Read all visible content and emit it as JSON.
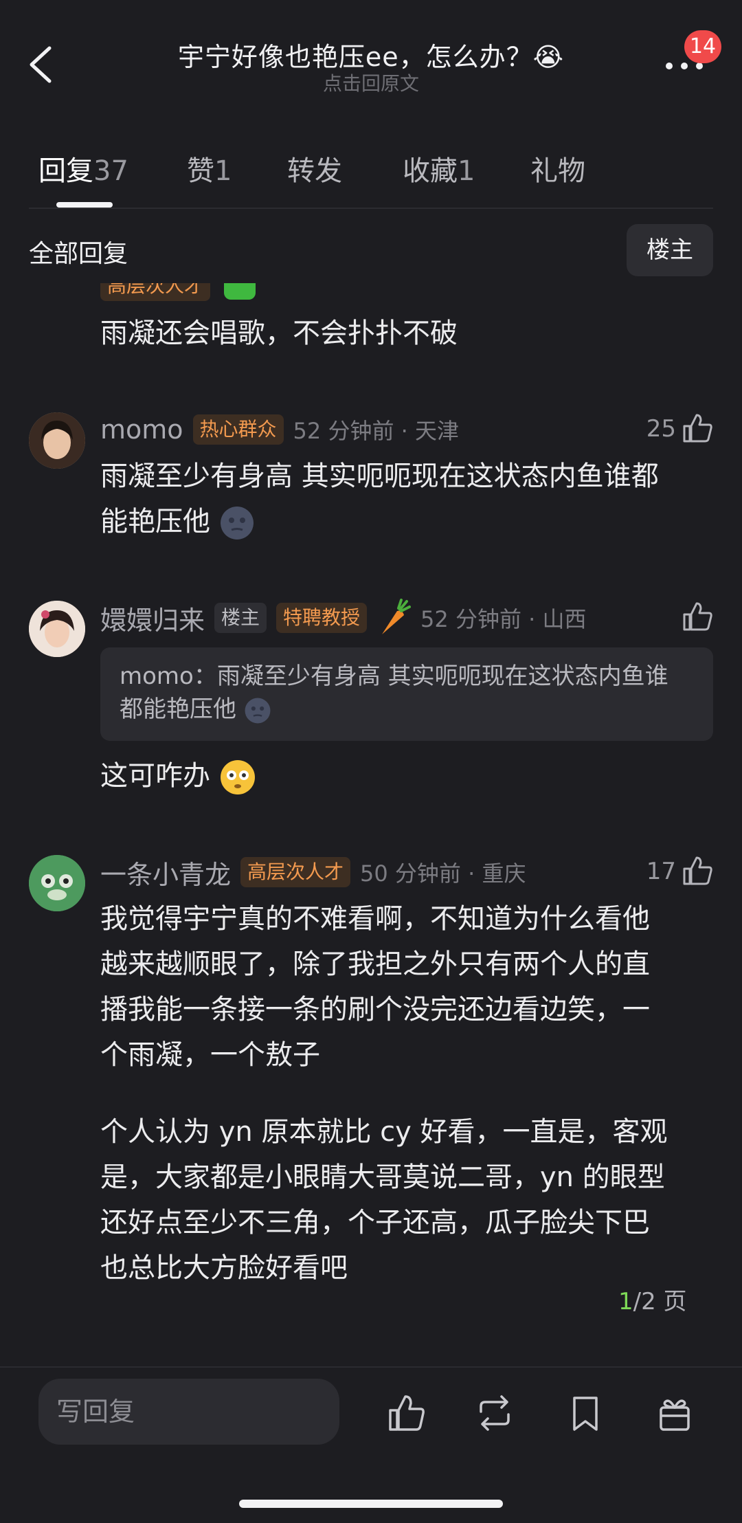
{
  "header": {
    "title": "宇宁好像也艳压ee，怎么办？😭",
    "subtitle": "点击回原文",
    "notification_count": "14"
  },
  "tabs": [
    {
      "label": "回复",
      "count": "37",
      "active": true
    },
    {
      "label": "赞",
      "count": "1",
      "active": false
    },
    {
      "label": "转发",
      "count": "",
      "active": false
    },
    {
      "label": "收藏",
      "count": "1",
      "active": false
    },
    {
      "label": "礼物",
      "count": "",
      "active": false
    }
  ],
  "section": {
    "title": "全部回复",
    "owner_filter": "楼主"
  },
  "comments": [
    {
      "username": "",
      "badge": "高层次人才",
      "content": "雨凝还会唱歌，不会扑扑不破"
    },
    {
      "username": "momo",
      "badge": "热心群众",
      "meta": "52 分钟前 · 天津",
      "likes": "25",
      "content_line1": "雨凝至少有身高 其实呃呃现在这状态内鱼谁都",
      "content_line2": "能艳压他"
    },
    {
      "username": "嬛嬛归来",
      "badge_owner": "楼主",
      "badge": "特聘教授",
      "meta": "52 分钟前 · 山西",
      "likes": "",
      "quote_line1": "momo：雨凝至少有身高 其实呃呃现在这状态内鱼谁",
      "quote_line2": "都能艳压他",
      "content": "这可咋办"
    },
    {
      "username": "一条小青龙",
      "badge": "高层次人才",
      "meta": "50 分钟前 · 重庆",
      "likes": "17",
      "para1": [
        "我觉得宇宁真的不难看啊，不知道为什么看他",
        "越来越顺眼了，除了我担之外只有两个人的直",
        "播我能一条接一条的刷个没完还边看边笑，一",
        "个雨凝，一个敖子"
      ],
      "para2": [
        "个人认为 yn 原本就比 cy 好看，一直是，客观",
        "是，大家都是小眼睛大哥莫说二哥，yn 的眼型",
        "还好点至少不三角，个子还高，瓜子脸尖下巴",
        "也总比大方脸好看吧"
      ]
    }
  ],
  "pagination": {
    "current": "1",
    "total": "/2 页"
  },
  "bottom_bar": {
    "reply_placeholder": "写回复"
  },
  "colors": {
    "background": "#1d1d21",
    "badge_orange": "#f39a4f",
    "notification": "#f04a4a",
    "page_current": "#7ed957"
  }
}
